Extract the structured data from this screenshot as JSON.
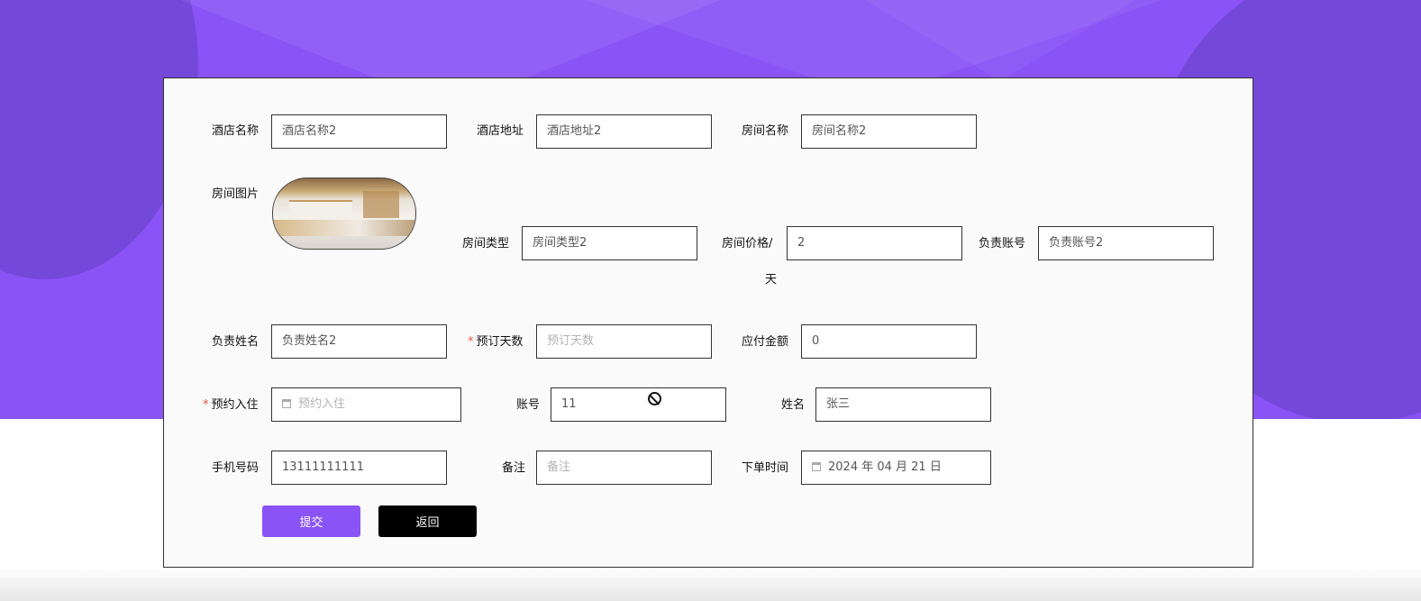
{
  "form": {
    "hotel_name": {
      "label": "酒店名称",
      "value": "酒店名称2"
    },
    "hotel_address": {
      "label": "酒店地址",
      "value": "酒店地址2"
    },
    "room_name": {
      "label": "房间名称",
      "value": "房间名称2"
    },
    "room_image": {
      "label": "房间图片"
    },
    "room_type": {
      "label": "房间类型",
      "value": "房间类型2"
    },
    "room_price": {
      "label": "房间价格/",
      "label_line2": "天",
      "value": "2"
    },
    "owner_account": {
      "label": "负责账号",
      "value": "负责账号2"
    },
    "owner_name": {
      "label": "负责姓名",
      "value": "负责姓名2"
    },
    "booking_days": {
      "label": "预订天数",
      "required_mark": "*",
      "placeholder": "预订天数"
    },
    "amount_due": {
      "label": "应付金额",
      "value": "0"
    },
    "checkin": {
      "label": "预约入住",
      "required_mark": "*",
      "placeholder": "预约入住"
    },
    "account": {
      "label": "账号",
      "value": "11"
    },
    "name": {
      "label": "姓名",
      "value": "张三"
    },
    "phone": {
      "label": "手机号码",
      "value": "13111111111"
    },
    "remark": {
      "label": "备注",
      "placeholder": "备注"
    },
    "order_time": {
      "label": "下单时间",
      "value": "2024 年 04 月 21 日"
    }
  },
  "buttons": {
    "submit": "提交",
    "back": "返回"
  },
  "colors": {
    "accent": "#8a53f6",
    "background_purple": "#8a53f6",
    "required": "#e5533d"
  },
  "icons": [
    "calendar-icon",
    "not-allowed-cursor-icon"
  ]
}
